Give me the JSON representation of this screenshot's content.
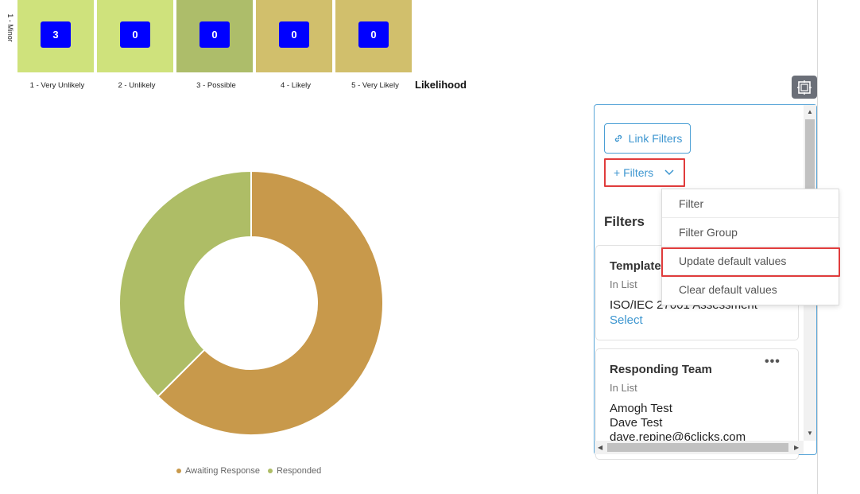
{
  "matrix": {
    "row_label": "1 - Minor",
    "axis_label": "Likelihood",
    "cells": [
      {
        "value": "3",
        "color": "#cfe27c"
      },
      {
        "value": "0",
        "color": "#cfe27c"
      },
      {
        "value": "0",
        "color": "#adbd6a"
      },
      {
        "value": "0",
        "color": "#d1bf6c"
      },
      {
        "value": "0",
        "color": "#d1bf6c"
      }
    ],
    "columns": [
      "1 - Very Unlikely",
      "2 - Unlikely",
      "3 - Possible",
      "4 - Likely",
      "5 - Very Likely"
    ]
  },
  "chart_data": {
    "type": "pie",
    "donut": true,
    "categories": [
      "Awaiting Response",
      "Responded"
    ],
    "values": [
      62.5,
      37.5
    ],
    "colors": [
      "#c8994b",
      "#aebd66"
    ],
    "legend_position": "bottom"
  },
  "legend": {
    "awaiting": "Awaiting Response",
    "responded": "Responded"
  },
  "panel": {
    "link_filters": "Link Filters",
    "add_filters": "+ Filters",
    "heading": "Filters",
    "cards": [
      {
        "title": "Template",
        "operator": "In List",
        "values": [
          "ISO/IEC 27001 Assessment"
        ],
        "action": "Select"
      },
      {
        "title": "Responding Team",
        "operator": "In List",
        "values": [
          "Amogh Test",
          "Dave Test",
          "dave.repine@6clicks.com"
        ]
      }
    ]
  },
  "menu": {
    "items": [
      "Filter",
      "Filter Group",
      "Update default values",
      "Clear default values"
    ]
  },
  "icons": {
    "expand": "expand-icon",
    "link": "link-icon",
    "chevron": "chevron-down-icon",
    "more": "more-dots-icon"
  },
  "highlight_color": "#e03c3c"
}
